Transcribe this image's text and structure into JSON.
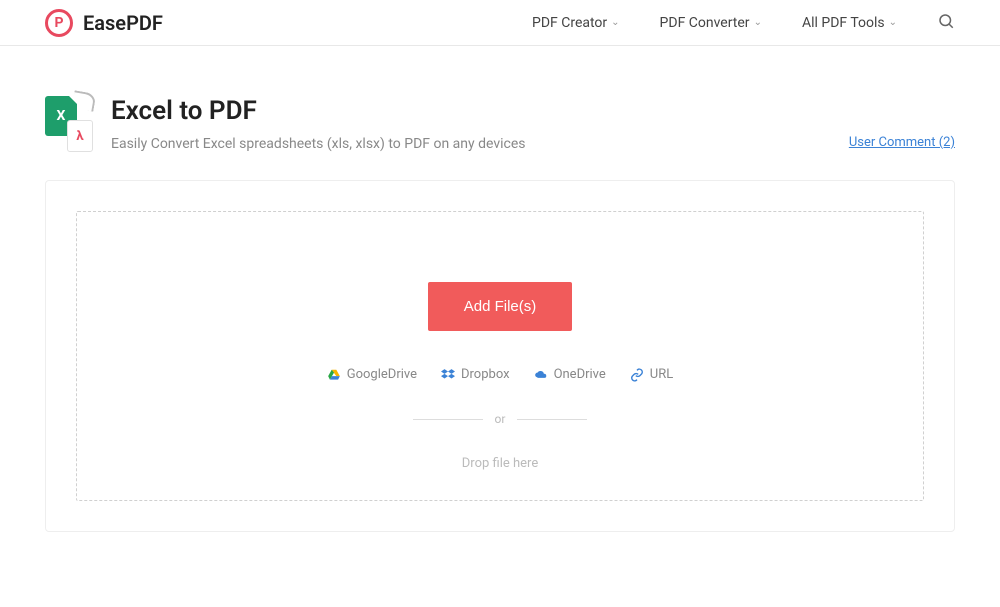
{
  "brand": {
    "name": "EasePDF",
    "logo_letter": "P"
  },
  "nav": {
    "items": [
      {
        "label": "PDF Creator"
      },
      {
        "label": "PDF Converter"
      },
      {
        "label": "All PDF Tools"
      }
    ]
  },
  "page": {
    "title": "Excel to PDF",
    "subtitle": "Easily Convert Excel spreadsheets (xls, xlsx) to PDF on any devices",
    "user_comment_label": "User Comment (2)",
    "excel_badge": "X",
    "pdf_badge": "λ"
  },
  "upload": {
    "add_button": "Add File(s)",
    "sources": [
      {
        "label": "GoogleDrive"
      },
      {
        "label": "Dropbox"
      },
      {
        "label": "OneDrive"
      },
      {
        "label": "URL"
      }
    ],
    "or_label": "or",
    "drop_hint": "Drop file here"
  }
}
